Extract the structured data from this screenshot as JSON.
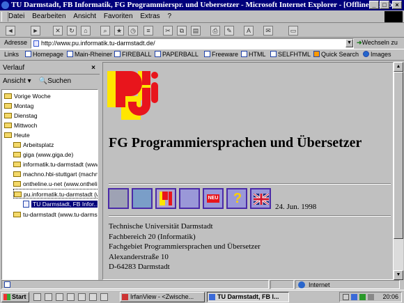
{
  "window": {
    "title": "TU Darmstadt, FB Informatik, FG Programmierspr. und Uebersetzer - Microsoft Internet Explorer - [Offlinebetrieb]",
    "min": "_",
    "max": "□",
    "close": "×"
  },
  "menu": [
    "Datei",
    "Bearbeiten",
    "Ansicht",
    "Favoriten",
    "Extras",
    "?"
  ],
  "address": {
    "label": "Adresse",
    "url": "http://www.pu.informatik.tu-darmstadt.de/",
    "go": "Wechseln zu"
  },
  "links": {
    "label": "Links",
    "items": [
      "Homepage",
      "Main-Rheiner",
      "FIREBALL",
      "PAPERBALL",
      "Freeware",
      "HTML",
      "SELFHTML",
      "Quick Search",
      "Images"
    ]
  },
  "history": {
    "title": "Verlauf",
    "close": "×",
    "view": "Ansicht",
    "search": "Suchen",
    "items": [
      "Vorige Woche",
      "Montag",
      "Dienstag",
      "Mittwoch",
      "Heute",
      "Arbeitsplatz",
      "giga (www.giga.de)",
      "informatik.tu-darmstadt (www...",
      "machno.hbi-stuttgart (machn...",
      "ontheline.u-net (www.ontheli...",
      "pu.informatik.tu-darmstadt (w...",
      "TU Darmstadt, FB Infor...",
      "tu-darmstadt (www.tu-darmst..."
    ]
  },
  "page": {
    "heading": "FG Programmiersprachen und Übersetzer",
    "date": "24. Jun. 1998",
    "address_lines": [
      "Technische Universität Darmstadt",
      "Fachbereich 20 (Informatik)",
      "Fachgebiet Programmiersprachen und Übersetzer",
      "Alexanderstraße 10",
      "D-64283 Darmstadt"
    ],
    "nav_icons": [
      "face-icon",
      "keyboard-icon",
      "pu-logo-icon",
      "pages-icon",
      "new-icon",
      "question-icon",
      "uk-flag-icon"
    ],
    "new_badge": "NEU",
    "question_mark": "?"
  },
  "status": {
    "zone": "Internet"
  },
  "taskbar": {
    "start": "Start",
    "tasks": [
      "IrfanView - <Zwische...",
      "TU Darmstadt, FB I..."
    ],
    "clock": "20:06"
  },
  "colors": {
    "titlebar": "#00007b",
    "logo_red": "#e8151c",
    "logo_yellow": "#ffe600"
  }
}
